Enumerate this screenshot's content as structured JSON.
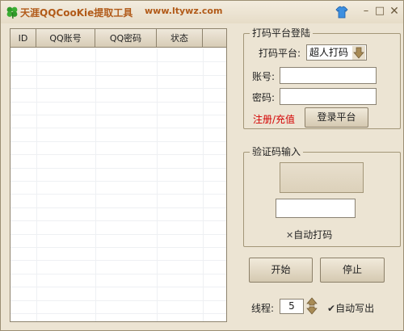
{
  "window": {
    "title": "天涯QQCooKie提取工具",
    "url": "www.ltywz.com"
  },
  "table": {
    "columns": [
      "ID",
      "QQ账号",
      "QQ密码",
      "状态",
      ""
    ],
    "rows": []
  },
  "platform_group": {
    "label": "打码平台登陆",
    "platform_label": "打码平台:",
    "platform_value": "超人打码",
    "account_label": "账号:",
    "account_value": "",
    "password_label": "密码:",
    "password_value": "",
    "register_link": "注册/充值",
    "login_button": "登录平台"
  },
  "captcha_group": {
    "label": "验证码输入",
    "input_value": "",
    "auto_label": "自动打码",
    "auto_checked": false
  },
  "controls": {
    "start_button": "开始",
    "stop_button": "停止",
    "threads_label": "线程:",
    "threads_value": "5",
    "auto_write_label": "自动写出",
    "auto_write_checked": true
  },
  "colors": {
    "title_text": "#b15a18",
    "link_red": "#d40000",
    "window_bg": "#ece4d3"
  },
  "icons": {
    "app": "clover-icon",
    "skin": "skin-shirt-icon",
    "combo_arrow": "down-arrow-icon",
    "spinner": "up-down-arrow-icon"
  }
}
